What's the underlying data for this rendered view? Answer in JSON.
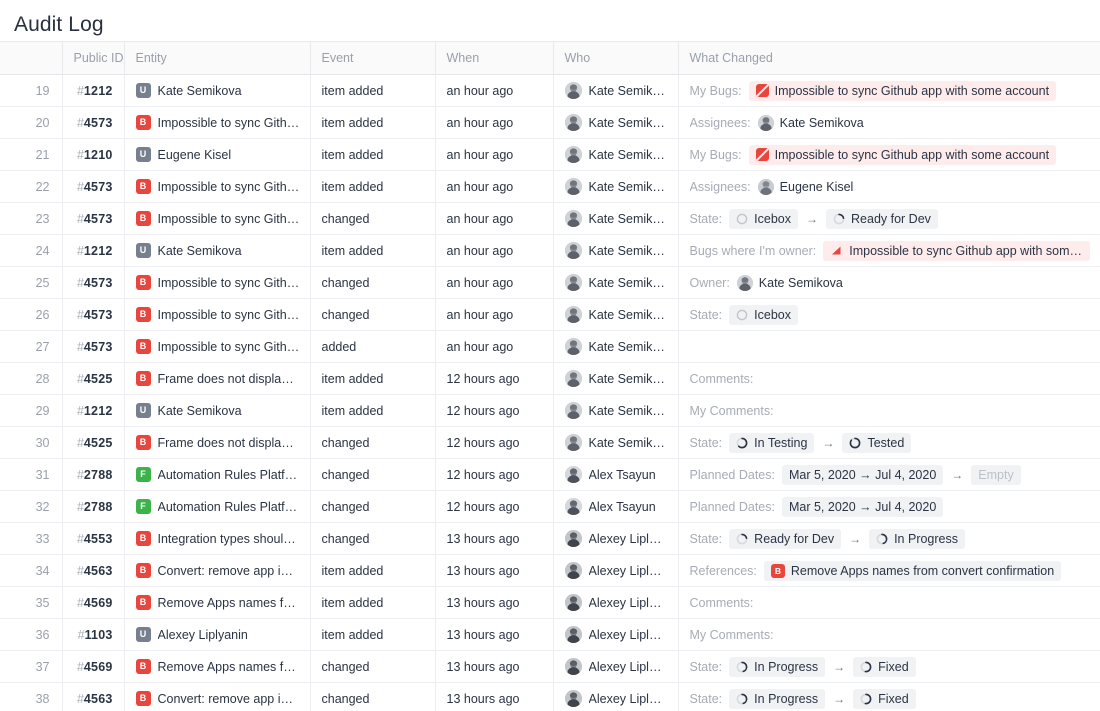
{
  "page": {
    "title": "Audit Log"
  },
  "colors": {
    "bug": "#e8453c",
    "user": "#76808f",
    "feature": "#3cb34a",
    "pink_badge_bg": "#fdeceb",
    "chip_bg": "#f1f2f4",
    "muted_text": "#a6acb7",
    "header_bg": "#fafafb"
  },
  "table": {
    "columns": [
      {
        "key": "index",
        "label": ""
      },
      {
        "key": "public_id",
        "label": "Public ID"
      },
      {
        "key": "entity",
        "label": "Entity"
      },
      {
        "key": "event",
        "label": "Event"
      },
      {
        "key": "when",
        "label": "When"
      },
      {
        "key": "who",
        "label": "Who"
      },
      {
        "key": "what_changed",
        "label": "What Changed"
      }
    ],
    "rows": [
      {
        "index": "19",
        "public_id": "#1212",
        "entity": {
          "type": "user",
          "badge": "U",
          "name": "Kate Semikova"
        },
        "event": "item added",
        "when": "an hour ago",
        "who": {
          "name": "Kate Semikova",
          "avatar": "kate"
        },
        "what": {
          "label": "My Bugs:",
          "items": [
            {
              "kind": "chip",
              "style": "pink",
              "icon": "slash",
              "text": "Impossible to sync Github app with some account"
            }
          ]
        }
      },
      {
        "index": "20",
        "public_id": "#4573",
        "entity": {
          "type": "bug",
          "badge": "B",
          "name": "Impossible to sync Github ..."
        },
        "event": "item added",
        "when": "an hour ago",
        "who": {
          "name": "Kate Semikova",
          "avatar": "kate"
        },
        "what": {
          "label": "Assignees:",
          "items": [
            {
              "kind": "avatar-text",
              "avatar": "kate",
              "text": "Kate Semikova"
            }
          ]
        }
      },
      {
        "index": "21",
        "public_id": "#1210",
        "entity": {
          "type": "user",
          "badge": "U",
          "name": "Eugene Kisel"
        },
        "event": "item added",
        "when": "an hour ago",
        "who": {
          "name": "Kate Semikova",
          "avatar": "kate"
        },
        "what": {
          "label": "My Bugs:",
          "items": [
            {
              "kind": "chip",
              "style": "pink",
              "icon": "slash",
              "text": "Impossible to sync Github app with some account"
            }
          ]
        }
      },
      {
        "index": "22",
        "public_id": "#4573",
        "entity": {
          "type": "bug",
          "badge": "B",
          "name": "Impossible to sync Github ..."
        },
        "event": "item added",
        "when": "an hour ago",
        "who": {
          "name": "Kate Semikova",
          "avatar": "kate"
        },
        "what": {
          "label": "Assignees:",
          "items": [
            {
              "kind": "avatar-text",
              "avatar": "eugene",
              "text": "Eugene Kisel"
            }
          ]
        }
      },
      {
        "index": "23",
        "public_id": "#4573",
        "entity": {
          "type": "bug",
          "badge": "B",
          "name": "Impossible to sync Github ..."
        },
        "event": "changed",
        "when": "an hour ago",
        "who": {
          "name": "Kate Semikova",
          "avatar": "kate"
        },
        "what": {
          "label": "State:",
          "items": [
            {
              "kind": "chip",
              "style": "plain",
              "icon": "ring0",
              "text": "Icebox"
            },
            {
              "kind": "arrow",
              "text": "→"
            },
            {
              "kind": "chip",
              "style": "plain",
              "icon": "ring25",
              "text": "Ready for Dev"
            }
          ]
        }
      },
      {
        "index": "24",
        "public_id": "#1212",
        "entity": {
          "type": "user",
          "badge": "U",
          "name": "Kate Semikova"
        },
        "event": "item added",
        "when": "an hour ago",
        "who": {
          "name": "Kate Semikova",
          "avatar": "kate"
        },
        "what": {
          "label": "Bugs where I'm owner:",
          "items": [
            {
              "kind": "chip",
              "style": "pink",
              "icon": "triangle",
              "text": "Impossible to sync Github app with some acc..."
            }
          ]
        }
      },
      {
        "index": "25",
        "public_id": "#4573",
        "entity": {
          "type": "bug",
          "badge": "B",
          "name": "Impossible to sync Github ..."
        },
        "event": "changed",
        "when": "an hour ago",
        "who": {
          "name": "Kate Semikova",
          "avatar": "kate"
        },
        "what": {
          "label": "Owner:",
          "items": [
            {
              "kind": "avatar-text",
              "avatar": "kate",
              "text": "Kate Semikova"
            }
          ]
        }
      },
      {
        "index": "26",
        "public_id": "#4573",
        "entity": {
          "type": "bug",
          "badge": "B",
          "name": "Impossible to sync Github ..."
        },
        "event": "changed",
        "when": "an hour ago",
        "who": {
          "name": "Kate Semikova",
          "avatar": "kate"
        },
        "what": {
          "label": "State:",
          "items": [
            {
              "kind": "chip",
              "style": "plain",
              "icon": "ring0",
              "text": "Icebox"
            }
          ]
        }
      },
      {
        "index": "27",
        "public_id": "#4573",
        "entity": {
          "type": "bug",
          "badge": "B",
          "name": "Impossible to sync Github ..."
        },
        "event": "added",
        "when": "an hour ago",
        "who": {
          "name": "Kate Semikova",
          "avatar": "kate"
        },
        "what": {
          "label": "",
          "items": []
        }
      },
      {
        "index": "28",
        "public_id": "#4525",
        "entity": {
          "type": "bug",
          "badge": "B",
          "name": "Frame does not display on..."
        },
        "event": "item added",
        "when": "12 hours ago",
        "who": {
          "name": "Kate Semikova",
          "avatar": "kate"
        },
        "what": {
          "label": "Comments:",
          "items": []
        }
      },
      {
        "index": "29",
        "public_id": "#1212",
        "entity": {
          "type": "user",
          "badge": "U",
          "name": "Kate Semikova"
        },
        "event": "item added",
        "when": "12 hours ago",
        "who": {
          "name": "Kate Semikova",
          "avatar": "kate"
        },
        "what": {
          "label": "My Comments:",
          "items": []
        }
      },
      {
        "index": "30",
        "public_id": "#4525",
        "entity": {
          "type": "bug",
          "badge": "B",
          "name": "Frame does not display on..."
        },
        "event": "changed",
        "when": "12 hours ago",
        "who": {
          "name": "Kate Semikova",
          "avatar": "kate"
        },
        "what": {
          "label": "State:",
          "items": [
            {
              "kind": "chip",
              "style": "plain",
              "icon": "ring60",
              "text": "In Testing"
            },
            {
              "kind": "arrow",
              "text": "→"
            },
            {
              "kind": "chip",
              "style": "plain",
              "icon": "ring85",
              "text": "Tested"
            }
          ]
        }
      },
      {
        "index": "31",
        "public_id": "#2788",
        "entity": {
          "type": "feature",
          "badge": "F",
          "name": "Automation Rules Platform..."
        },
        "event": "changed",
        "when": "12 hours ago",
        "who": {
          "name": "Alex Tsayun",
          "avatar": "alex"
        },
        "what": {
          "label": "Planned Dates:",
          "items": [
            {
              "kind": "chip",
              "style": "plain",
              "text": "Mar 5, 2020 → Jul 4, 2020"
            },
            {
              "kind": "arrow",
              "text": "→"
            },
            {
              "kind": "chip",
              "style": "empty",
              "text": "Empty"
            }
          ]
        }
      },
      {
        "index": "32",
        "public_id": "#2788",
        "entity": {
          "type": "feature",
          "badge": "F",
          "name": "Automation Rules Platform..."
        },
        "event": "changed",
        "when": "12 hours ago",
        "who": {
          "name": "Alex Tsayun",
          "avatar": "alex"
        },
        "what": {
          "label": "Planned Dates:",
          "items": [
            {
              "kind": "chip",
              "style": "plain",
              "text": "Mar 5, 2020 → Jul 4, 2020"
            }
          ]
        }
      },
      {
        "index": "33",
        "public_id": "#4553",
        "entity": {
          "type": "bug",
          "badge": "B",
          "name": "Integration types should n..."
        },
        "event": "changed",
        "when": "13 hours ago",
        "who": {
          "name": "Alexey Liplyanin",
          "avatar": "alexey"
        },
        "what": {
          "label": "State:",
          "items": [
            {
              "kind": "chip",
              "style": "plain",
              "icon": "ring25",
              "text": "Ready for Dev"
            },
            {
              "kind": "arrow",
              "text": "→"
            },
            {
              "kind": "chip",
              "style": "plain",
              "icon": "ring45",
              "text": "In Progress"
            }
          ]
        }
      },
      {
        "index": "34",
        "public_id": "#4563",
        "entity": {
          "type": "bug",
          "badge": "B",
          "name": "Convert: remove app in co..."
        },
        "event": "item added",
        "when": "13 hours ago",
        "who": {
          "name": "Alexey Liplyanin",
          "avatar": "alexey"
        },
        "what": {
          "label": "References:",
          "items": [
            {
              "kind": "chip",
              "style": "plain",
              "icon": "etype-bug",
              "text": "Remove Apps names from convert confirmation"
            }
          ]
        }
      },
      {
        "index": "35",
        "public_id": "#4569",
        "entity": {
          "type": "bug",
          "badge": "B",
          "name": "Remove Apps names from ..."
        },
        "event": "item added",
        "when": "13 hours ago",
        "who": {
          "name": "Alexey Liplyanin",
          "avatar": "alexey"
        },
        "what": {
          "label": "Comments:",
          "items": []
        }
      },
      {
        "index": "36",
        "public_id": "#1103",
        "entity": {
          "type": "user",
          "badge": "U",
          "name": "Alexey Liplyanin"
        },
        "event": "item added",
        "when": "13 hours ago",
        "who": {
          "name": "Alexey Liplyanin",
          "avatar": "alexey"
        },
        "what": {
          "label": "My Comments:",
          "items": []
        }
      },
      {
        "index": "37",
        "public_id": "#4569",
        "entity": {
          "type": "bug",
          "badge": "B",
          "name": "Remove Apps names from ..."
        },
        "event": "changed",
        "when": "13 hours ago",
        "who": {
          "name": "Alexey Liplyanin",
          "avatar": "alexey"
        },
        "what": {
          "label": "State:",
          "items": [
            {
              "kind": "chip",
              "style": "plain",
              "icon": "ring45",
              "text": "In Progress"
            },
            {
              "kind": "arrow",
              "text": "→"
            },
            {
              "kind": "chip",
              "style": "plain",
              "icon": "ring50",
              "text": "Fixed"
            }
          ]
        }
      },
      {
        "index": "38",
        "public_id": "#4563",
        "entity": {
          "type": "bug",
          "badge": "B",
          "name": "Convert: remove app in co..."
        },
        "event": "changed",
        "when": "13 hours ago",
        "who": {
          "name": "Alexey Liplyanin",
          "avatar": "alexey"
        },
        "what": {
          "label": "State:",
          "items": [
            {
              "kind": "chip",
              "style": "plain",
              "icon": "ring45",
              "text": "In Progress"
            },
            {
              "kind": "arrow",
              "text": "→"
            },
            {
              "kind": "chip",
              "style": "plain",
              "icon": "ring50",
              "text": "Fixed"
            }
          ]
        }
      }
    ]
  }
}
